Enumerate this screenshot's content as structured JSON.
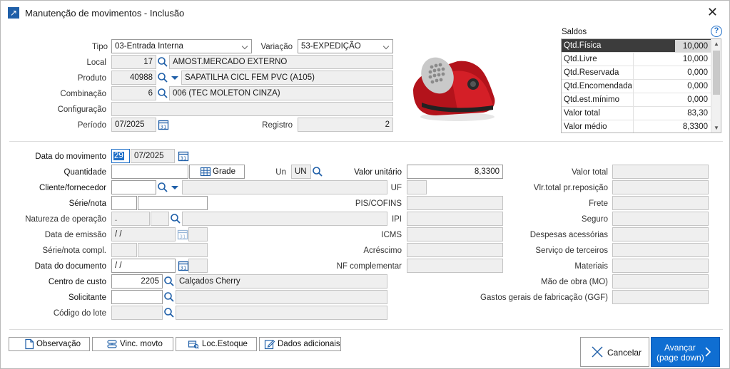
{
  "window": {
    "title": "Manutenção de movimentos - Inclusão"
  },
  "header": {
    "tipo_label": "Tipo",
    "tipo_value": "03-Entrada Interna",
    "variacao_label": "Variação",
    "variacao_value": "53-EXPEDIÇÃO",
    "local_label": "Local",
    "local_code": "17",
    "local_name": "AMOST.MERCADO EXTERNO",
    "produto_label": "Produto",
    "produto_code": "40988",
    "produto_name": "SAPATILHA CICL FEM PVC (A105)",
    "combinacao_label": "Combinação",
    "combinacao_code": "6",
    "combinacao_name": "006 (TEC MOLETON CINZA)",
    "configuracao_label": "Configuração",
    "configuracao_value": "",
    "periodo_label": "Período",
    "periodo_value": "07/2025",
    "registro_label": "Registro",
    "registro_value": "2"
  },
  "saldos": {
    "title": "Saldos",
    "rows": [
      {
        "label": "Qtd.Física",
        "value": "10,000"
      },
      {
        "label": "Qtd.Livre",
        "value": "10,000"
      },
      {
        "label": "Qtd.Reservada",
        "value": "0,000"
      },
      {
        "label": "Qtd.Encomendada",
        "value": "0,000"
      },
      {
        "label": "Qtd.est.mínimo",
        "value": "0,000"
      },
      {
        "label": "Valor total",
        "value": "83,30"
      },
      {
        "label": "Valor médio",
        "value": "8,3300"
      }
    ]
  },
  "form": {
    "data_mov_label": "Data do movimento",
    "data_mov_day": "29",
    "data_mov_month": "07/2025",
    "quantidade_label": "Quantidade",
    "quantidade_value": "",
    "grade_label": "Grade",
    "un_label": "Un",
    "un_value": "UN",
    "valor_unitario_label": "Valor unitário",
    "valor_unitario_value": "8,3300",
    "cliente_label": "Cliente/fornecedor",
    "uf_label": "UF",
    "serie_nota_label": "Série/nota",
    "pis_label": "PIS/COFINS",
    "natureza_label": "Natureza de operação",
    "natureza_value": ".",
    "ipi_label": "IPI",
    "data_emissao_label": "Data de emissão",
    "data_emissao_value": "/ /",
    "icms_label": "ICMS",
    "serie_compl_label": "Série/nota compl.",
    "acrescimo_label": "Acréscimo",
    "data_documento_label": "Data do documento",
    "data_documento_value": "/ /",
    "nf_compl_label": "NF complementar",
    "centro_custo_label": "Centro de custo",
    "centro_custo_code": "2205",
    "centro_custo_name": "Calçados Cherry",
    "solicitante_label": "Solicitante",
    "codigo_lote_label": "Código do lote"
  },
  "right_fields": [
    "Valor total",
    "Vlr.total pr.reposição",
    "Frete",
    "Seguro",
    "Despesas acessórias",
    "Serviço de terceiros",
    "Materiais",
    "Mão de obra (MO)",
    "Gastos gerais de fabricação (GGF)"
  ],
  "buttons": {
    "observacao": "Observação",
    "vinc_movto": "Vinc. movto",
    "loc_estoque": "Loc.Estoque",
    "dados_adicionais": "Dados adicionais",
    "cancelar": "Cancelar",
    "avancar": "Avançar",
    "avancar_sub": "(page down)"
  },
  "colors": {
    "accent": "#0f6ed2",
    "selected_row": "#3c3c3c",
    "icon_blue": "#1f5fa8"
  }
}
